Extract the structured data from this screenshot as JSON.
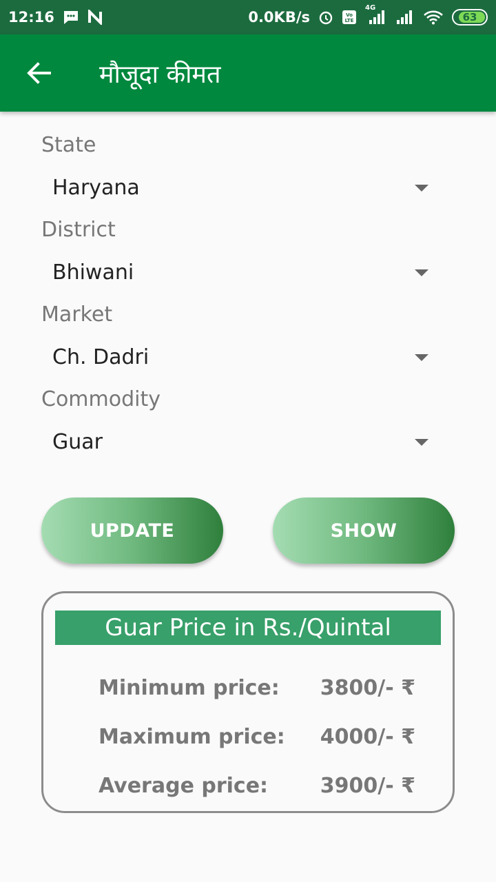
{
  "status_bar": {
    "time": "12:16",
    "speed": "0.0KB/s",
    "network": "4G",
    "battery": "63"
  },
  "app_bar": {
    "title": "मौजूदा कीमत"
  },
  "form": {
    "fields": [
      {
        "label": "State",
        "value": "Haryana"
      },
      {
        "label": "District",
        "value": "Bhiwani"
      },
      {
        "label": "Market",
        "value": "Ch. Dadri"
      },
      {
        "label": "Commodity",
        "value": "Guar"
      }
    ]
  },
  "buttons": {
    "update_label": "UPDATE",
    "show_label": "SHOW"
  },
  "price_card": {
    "header": "Guar Price in Rs./Quintal",
    "rows": [
      {
        "label": "Minimum price:",
        "value": "3800/- ₹"
      },
      {
        "label": "Maximum price:",
        "value": "4000/- ₹"
      },
      {
        "label": "Average price:",
        "value": "3900/- ₹"
      }
    ]
  },
  "colors": {
    "status_bar": "#1c6b3f",
    "app_bar": "#00883e",
    "price_header": "#38a06a",
    "button_gradient_start": "#a4dcb2",
    "button_gradient_end": "#2f7f3c"
  }
}
